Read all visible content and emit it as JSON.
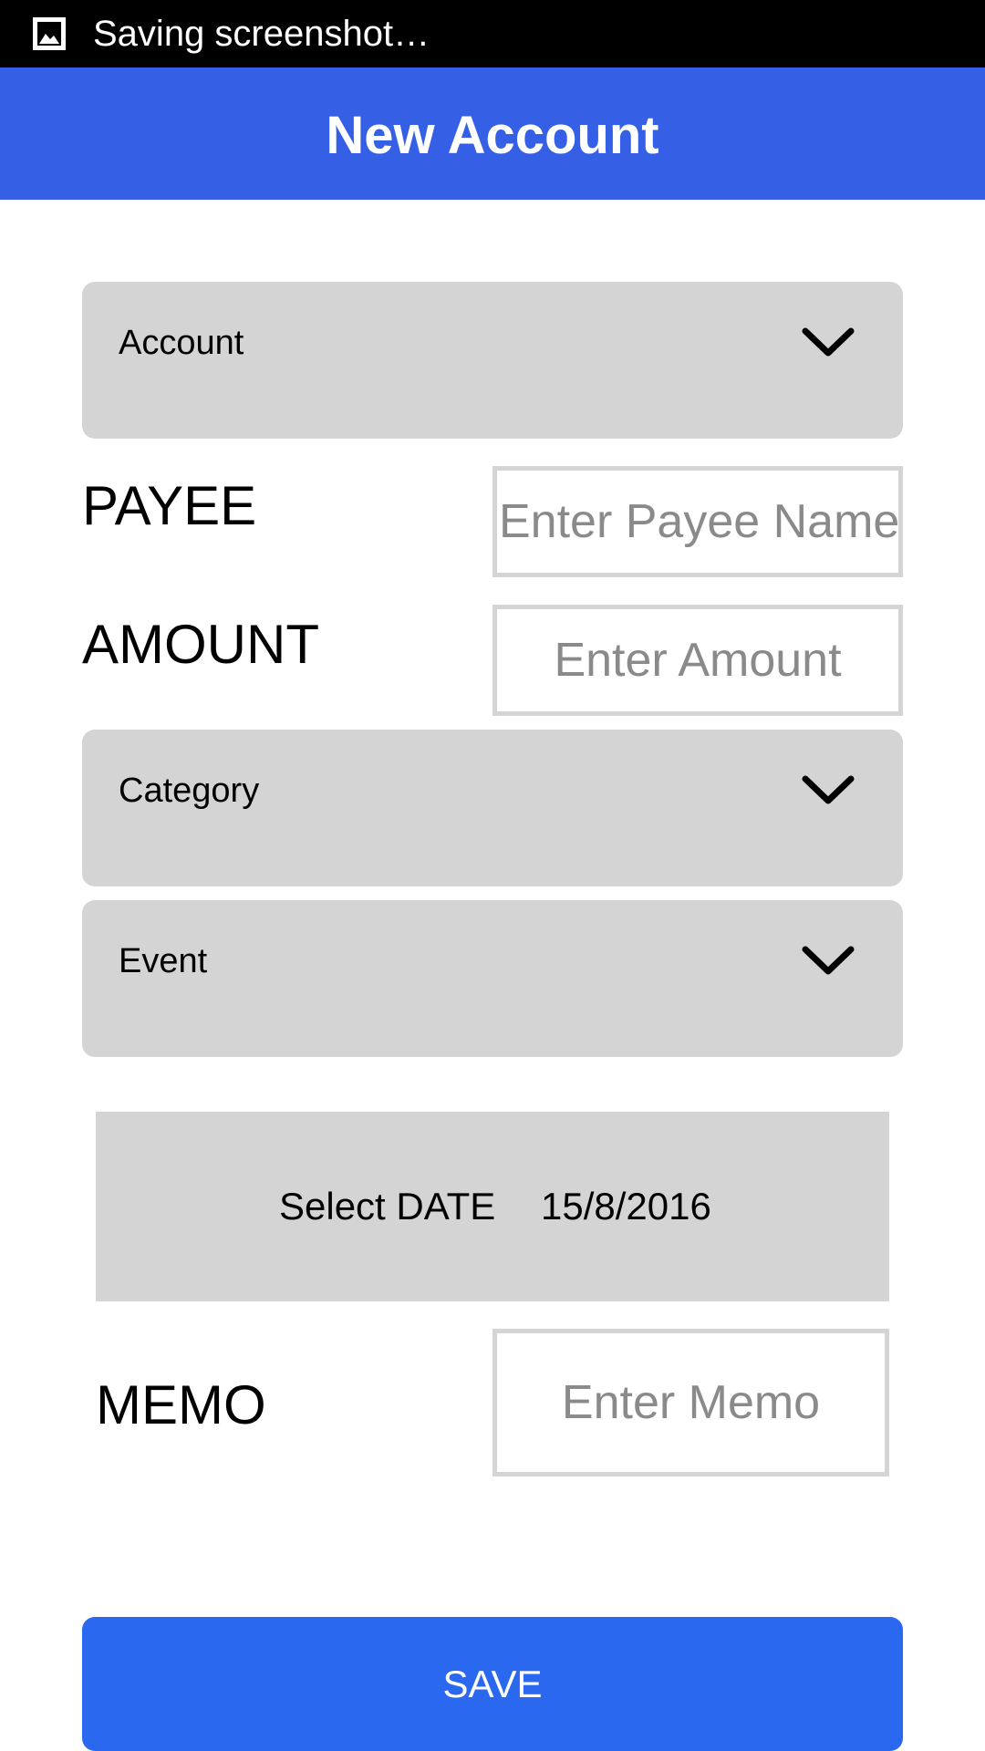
{
  "status_bar": {
    "icon": "image-icon",
    "text": "Saving screenshot…"
  },
  "app_bar": {
    "title": "New Account"
  },
  "form": {
    "account_select": {
      "label": "Account",
      "icon": "chevron-down-icon"
    },
    "payee": {
      "label": "PAYEE",
      "placeholder": "Enter Payee Name",
      "value": ""
    },
    "amount": {
      "label": "AMOUNT",
      "placeholder": "Enter Amount",
      "value": ""
    },
    "category_select": {
      "label": "Category",
      "icon": "chevron-down-icon"
    },
    "event_select": {
      "label": "Event",
      "icon": "chevron-down-icon"
    },
    "date": {
      "label": "Select DATE",
      "value": "15/8/2016"
    },
    "memo": {
      "label": "MEMO",
      "placeholder": "Enter Memo",
      "value": ""
    },
    "save_label": "SAVE"
  },
  "colors": {
    "app_bar": "#3560e6",
    "save_button": "#2a68f0",
    "field_background": "#d4d4d4",
    "status_bar": "#000000"
  }
}
